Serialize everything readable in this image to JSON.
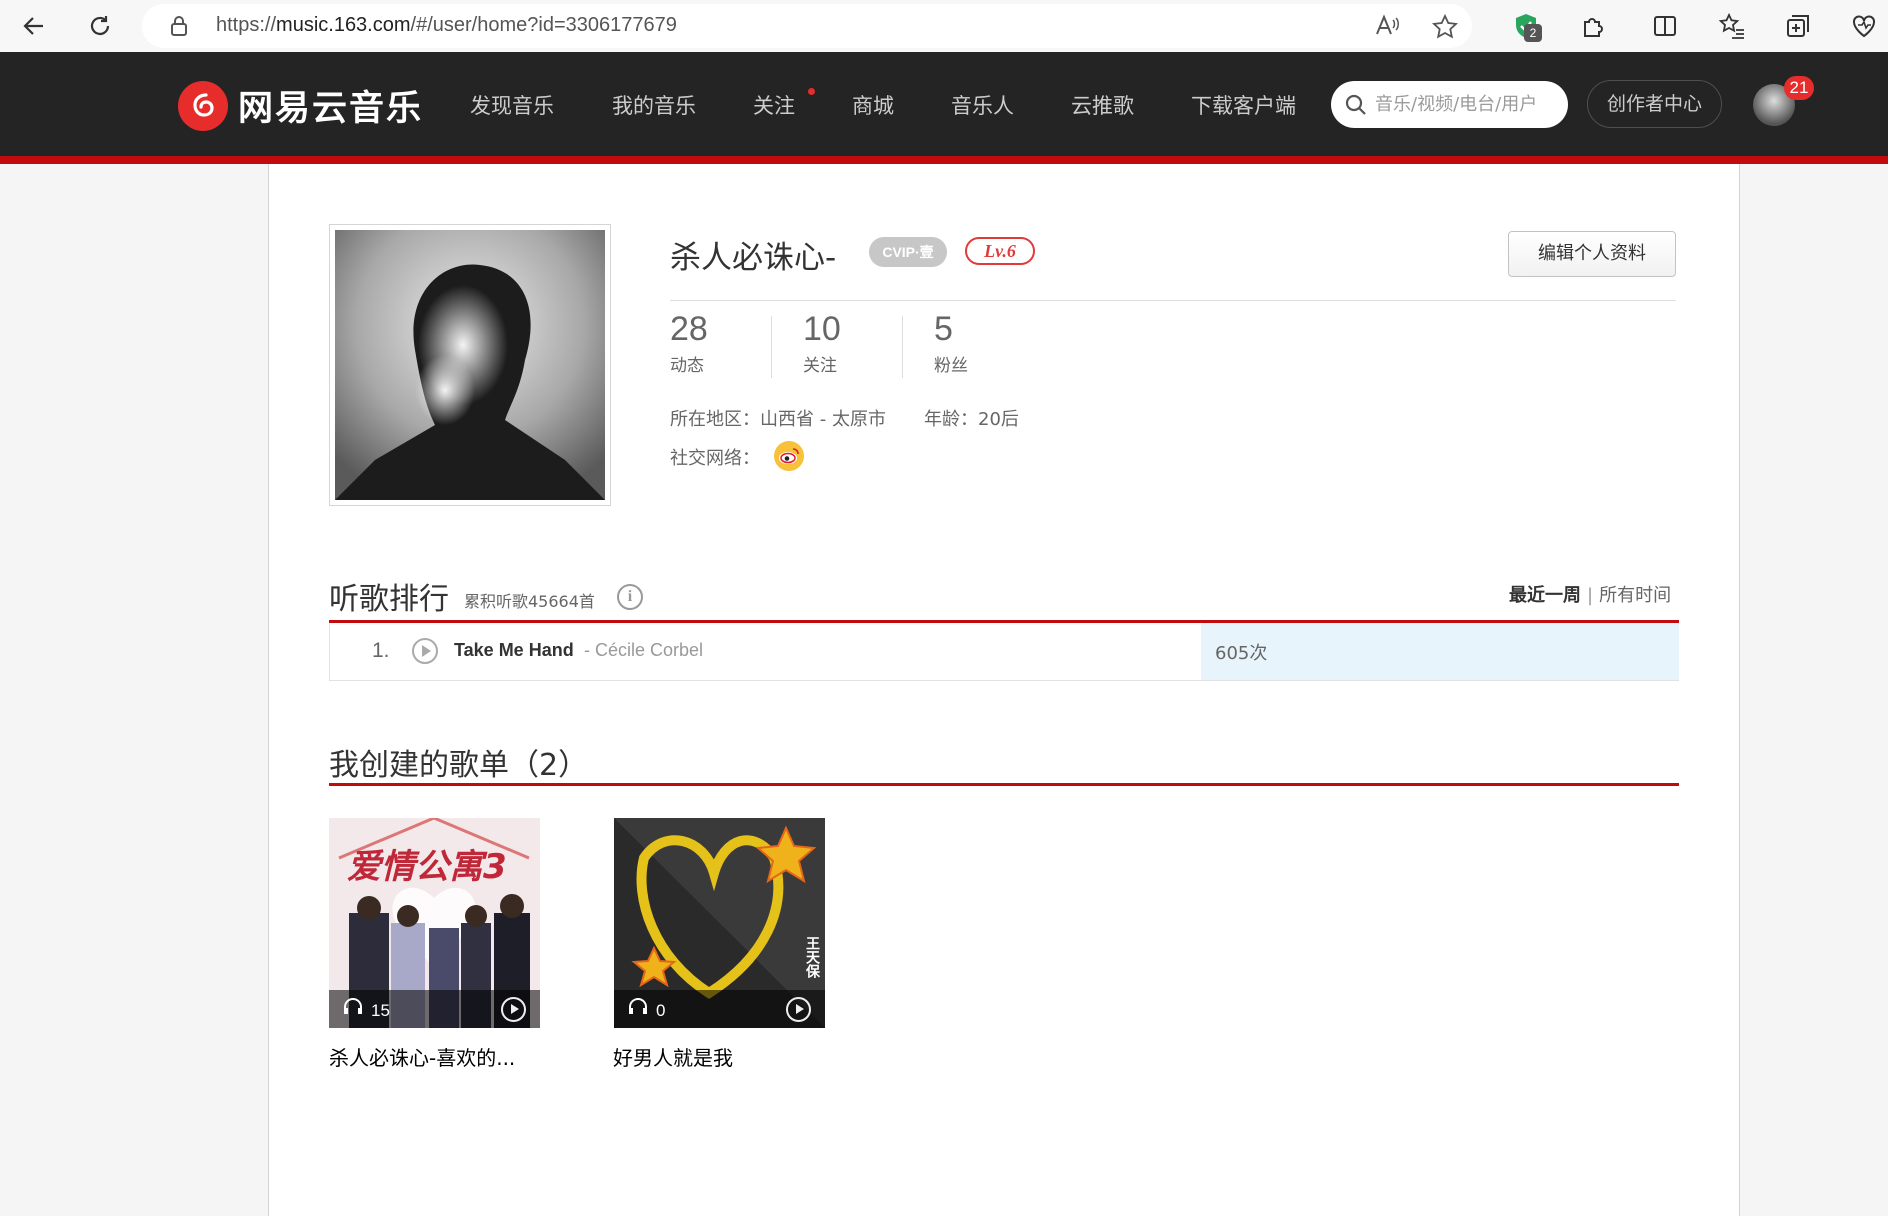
{
  "browser": {
    "url_scheme": "https://",
    "url_host": "music.163.com",
    "url_path": "/#/user/home?id=3306177679",
    "extension_badge": "2"
  },
  "header": {
    "logo_text": "网易云音乐",
    "nav": [
      "发现音乐",
      "我的音乐",
      "关注",
      "商城",
      "音乐人",
      "云推歌",
      "下载客户端"
    ],
    "search_placeholder": "音乐/视频/电台/用户",
    "creator_center": "创作者中心",
    "notification_count": "21",
    "colors": {
      "bg": "#242424",
      "accent": "#c20c0c"
    }
  },
  "profile": {
    "nickname": "杀人必诛心-",
    "vip_badge": "CVIP·壹",
    "level": "Lv.6",
    "edit_button": "编辑个人资料",
    "stats": [
      {
        "value": "28",
        "label": "动态"
      },
      {
        "value": "10",
        "label": "关注"
      },
      {
        "value": "5",
        "label": "粉丝"
      }
    ],
    "region_label": "所在地区：",
    "region_value": "山西省 - 太原市",
    "age_label": "年龄：",
    "age_value": "20后",
    "social_label": "社交网络：",
    "social_icon": "weibo-icon"
  },
  "ranking": {
    "title": "听歌排行",
    "subtitle": "累积听歌45664首",
    "info_glyph": "i",
    "range_active": "最近一周",
    "range_divider": "|",
    "range_other": "所有时间",
    "rows": [
      {
        "rank": "1.",
        "song": "Take Me Hand",
        "artist_sep": "-",
        "artist": "Cécile Corbel",
        "count": "605次"
      }
    ]
  },
  "playlists": {
    "title": "我创建的歌单（2）",
    "items": [
      {
        "name": "杀人必诛心-喜欢的...",
        "play_count": "15",
        "cover_text": "爱情公寓3"
      },
      {
        "name": "好男人就是我",
        "play_count": "0",
        "cover_text": "王天保"
      }
    ]
  }
}
